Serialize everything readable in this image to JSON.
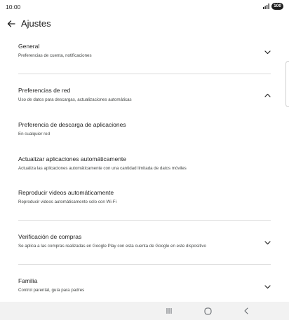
{
  "status_bar": {
    "time": "10:00",
    "battery": "100"
  },
  "header": {
    "title": "Ajustes"
  },
  "sections": {
    "general": {
      "title": "General",
      "subtitle": "Preferencias de cuenta, notificaciones"
    },
    "network": {
      "title": "Preferencias de red",
      "subtitle": "Uso de datos para descargas, actualizaciones automáticas"
    },
    "download_pref": {
      "title": "Preferencia de descarga de aplicaciones",
      "subtitle": "En cualquier red"
    },
    "auto_update": {
      "title": "Actualizar aplicaciones automáticamente",
      "subtitle": "Actualiza las aplicaciones automáticamente con una cantidad limitada de datos móviles"
    },
    "autoplay": {
      "title": "Reproducir videos automáticamente",
      "subtitle": "Reproducir videos automáticamente solo con Wi-Fi"
    },
    "purchase_verification": {
      "title": "Verificación de compras",
      "subtitle": "Se aplica a las compras realizadas en Google Play con esta cuenta de Google en este dispositivo"
    },
    "family": {
      "title": "Familia",
      "subtitle": "Control parental, guía para padres"
    }
  },
  "icons": {
    "back": "arrow-left-icon",
    "expand": "chevron-down-icon",
    "collapse": "chevron-up-icon",
    "nav_recents": "recents-icon",
    "nav_home": "home-icon",
    "nav_back": "back-icon"
  }
}
